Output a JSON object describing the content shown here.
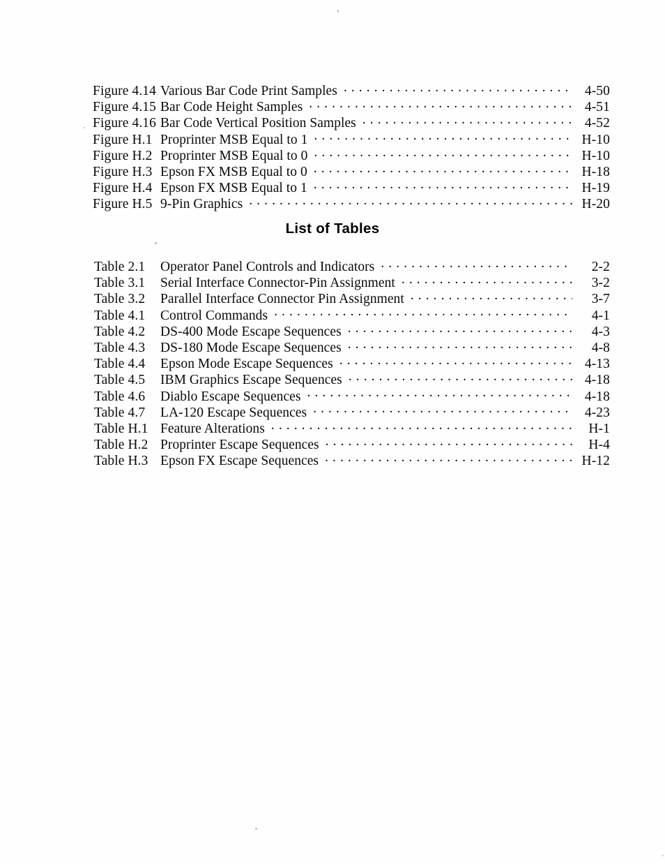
{
  "document": {
    "list_of_figures": {
      "entries": [
        {
          "label": "Figure 4.14",
          "title": "Various Bar Code Print Samples",
          "page": "4-50"
        },
        {
          "label": "Figure 4.15",
          "title": "Bar Code Height Samples",
          "page": "4-51"
        },
        {
          "label": "Figure 4.16",
          "title": "Bar Code Vertical Position Samples",
          "page": "4-52"
        },
        {
          "label": "Figure H.1",
          "title": "Proprinter MSB Equal to 1",
          "page": "H-10"
        },
        {
          "label": "Figure H.2",
          "title": "Proprinter MSB Equal to 0",
          "page": "H-10"
        },
        {
          "label": "Figure H.3",
          "title": "Epson FX MSB Equal to 0",
          "page": "H-18"
        },
        {
          "label": "Figure H.4",
          "title": "Epson FX MSB Equal to 1",
          "page": "H-19"
        },
        {
          "label": "Figure H.5",
          "title": "9-Pin Graphics",
          "page": "H-20"
        }
      ]
    },
    "list_of_tables": {
      "heading": "List of Tables",
      "entries": [
        {
          "label": "Table 2.1",
          "title": "Operator Panel Controls and Indicators",
          "page": "2-2"
        },
        {
          "label": "Table 3.1",
          "title": "Serial Interface Connector-Pin Assignment",
          "page": "3-2"
        },
        {
          "label": "Table 3.2",
          "title": "Parallel Interface Connector Pin Assignment",
          "page": "3-7"
        },
        {
          "label": "Table 4.1",
          "title": "Control Commands",
          "page": "4-1"
        },
        {
          "label": "Table 4.2",
          "title": "DS-400 Mode Escape Sequences",
          "page": "4-3"
        },
        {
          "label": "Table 4.3",
          "title": "DS-180 Mode Escape Sequences",
          "page": "4-8"
        },
        {
          "label": "Table 4.4",
          "title": "Epson Mode Escape Sequences",
          "page": "4-13"
        },
        {
          "label": "Table 4.5",
          "title": "IBM Graphics Escape Sequences",
          "page": "4-18"
        },
        {
          "label": "Table 4.6",
          "title": "Diablo Escape Sequences",
          "page": "4-18"
        },
        {
          "label": "Table 4.7",
          "title": "LA-120 Escape Sequences",
          "page": "4-23"
        },
        {
          "label": "Table H.1",
          "title": "Feature Alterations",
          "page": "H-1"
        },
        {
          "label": "Table H.2",
          "title": "Proprinter Escape Sequences",
          "page": "H-4"
        },
        {
          "label": "Table H.3",
          "title": "Epson FX Escape Sequences",
          "page": "H-12"
        }
      ]
    }
  }
}
